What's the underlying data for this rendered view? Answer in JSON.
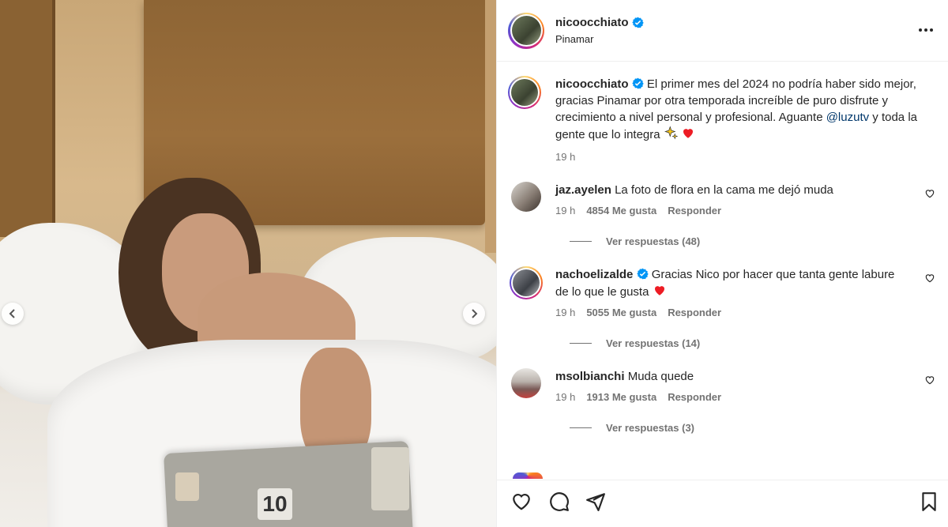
{
  "post": {
    "username": "nicoocchiato",
    "location": "Pinamar",
    "caption_prefix": "El primer mes del 2024 no podría haber sido mejor, gracias Pinamar por otra temporada increíble de puro disfrute y crecimiento a nivel personal y profesional. Aguante ",
    "caption_mention": "@luzutv",
    "caption_suffix": " y toda la gente que lo integra",
    "time": "19 h",
    "photo_sticker_text": "10"
  },
  "comments": [
    {
      "username": "jaz.ayelen",
      "verified": false,
      "text": "La foto de flora en la cama me dejó muda",
      "time": "19 h",
      "likes": "4854 Me gusta",
      "reply_label": "Responder",
      "replies_label": "Ver respuestas (48)"
    },
    {
      "username": "nachoelizalde",
      "verified": true,
      "text": "Gracias Nico por hacer que tanta gente labure de lo que le gusta",
      "time": "19 h",
      "likes": "5055 Me gusta",
      "reply_label": "Responder",
      "replies_label": "Ver respuestas (14)"
    },
    {
      "username": "msolbianchi",
      "verified": false,
      "text": "Muda quede",
      "time": "19 h",
      "likes": "1913 Me gusta",
      "reply_label": "Responder",
      "replies_label": "Ver respuestas (3)"
    }
  ],
  "colors": {
    "verified": "#0095f6",
    "heart_red": "#ed4956",
    "muted": "#737373",
    "mention": "#00376b"
  },
  "icons": [
    "chevron-left-icon",
    "chevron-right-icon",
    "more-icon",
    "verified-icon",
    "heart-icon",
    "comment-icon",
    "share-icon",
    "bookmark-icon",
    "sparkles-emoji",
    "red-heart-emoji"
  ]
}
